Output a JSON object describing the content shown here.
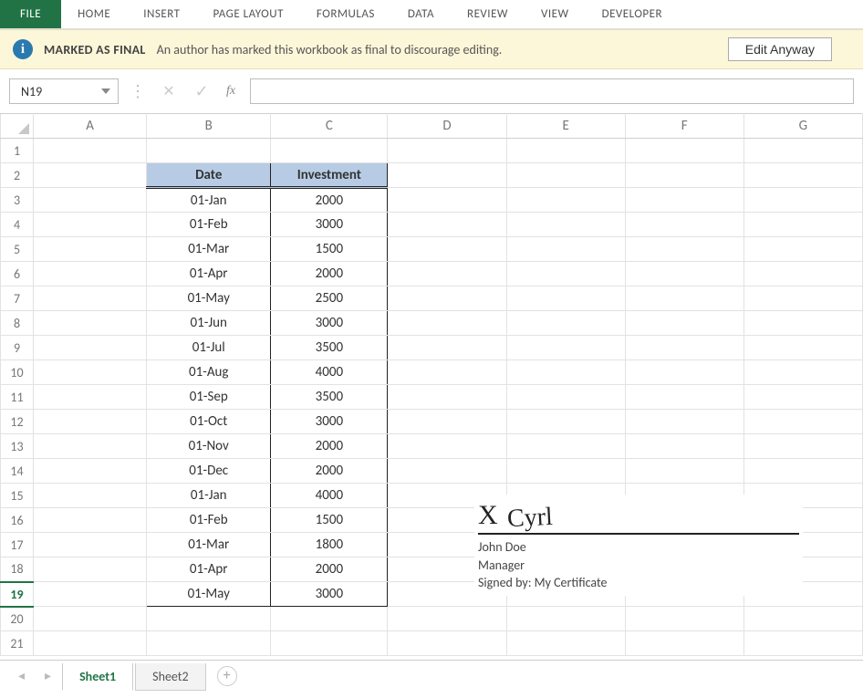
{
  "ribbon": {
    "file": "FILE",
    "tabs": [
      "HOME",
      "INSERT",
      "PAGE LAYOUT",
      "FORMULAS",
      "DATA",
      "REVIEW",
      "VIEW",
      "DEVELOPER"
    ]
  },
  "infobar": {
    "title": "MARKED AS FINAL",
    "message": "An author has marked this workbook as final to discourage editing.",
    "button": "Edit Anyway"
  },
  "namebox": "N19",
  "fx_label": "fx",
  "formula": "",
  "columns": [
    "A",
    "B",
    "C",
    "D",
    "E",
    "F",
    "G"
  ],
  "row_count": 21,
  "selected_row": 19,
  "table": {
    "headers": [
      "Date",
      "Investment"
    ],
    "rows": [
      [
        "01-Jan",
        "2000"
      ],
      [
        "01-Feb",
        "3000"
      ],
      [
        "01-Mar",
        "1500"
      ],
      [
        "01-Apr",
        "2000"
      ],
      [
        "01-May",
        "2500"
      ],
      [
        "01-Jun",
        "3000"
      ],
      [
        "01-Jul",
        "3500"
      ],
      [
        "01-Aug",
        "4000"
      ],
      [
        "01-Sep",
        "3500"
      ],
      [
        "01-Oct",
        "3000"
      ],
      [
        "01-Nov",
        "2000"
      ],
      [
        "01-Dec",
        "2000"
      ],
      [
        "01-Jan",
        "4000"
      ],
      [
        "01-Feb",
        "1500"
      ],
      [
        "01-Mar",
        "1800"
      ],
      [
        "01-Apr",
        "2000"
      ],
      [
        "01-May",
        "3000"
      ]
    ]
  },
  "signature": {
    "mark": "X",
    "name": "John Doe",
    "title": "Manager",
    "signed_by_label": "Signed by:",
    "signed_by": "My Certificate"
  },
  "sheets": {
    "tabs": [
      "Sheet1",
      "Sheet2"
    ],
    "active": 0
  }
}
